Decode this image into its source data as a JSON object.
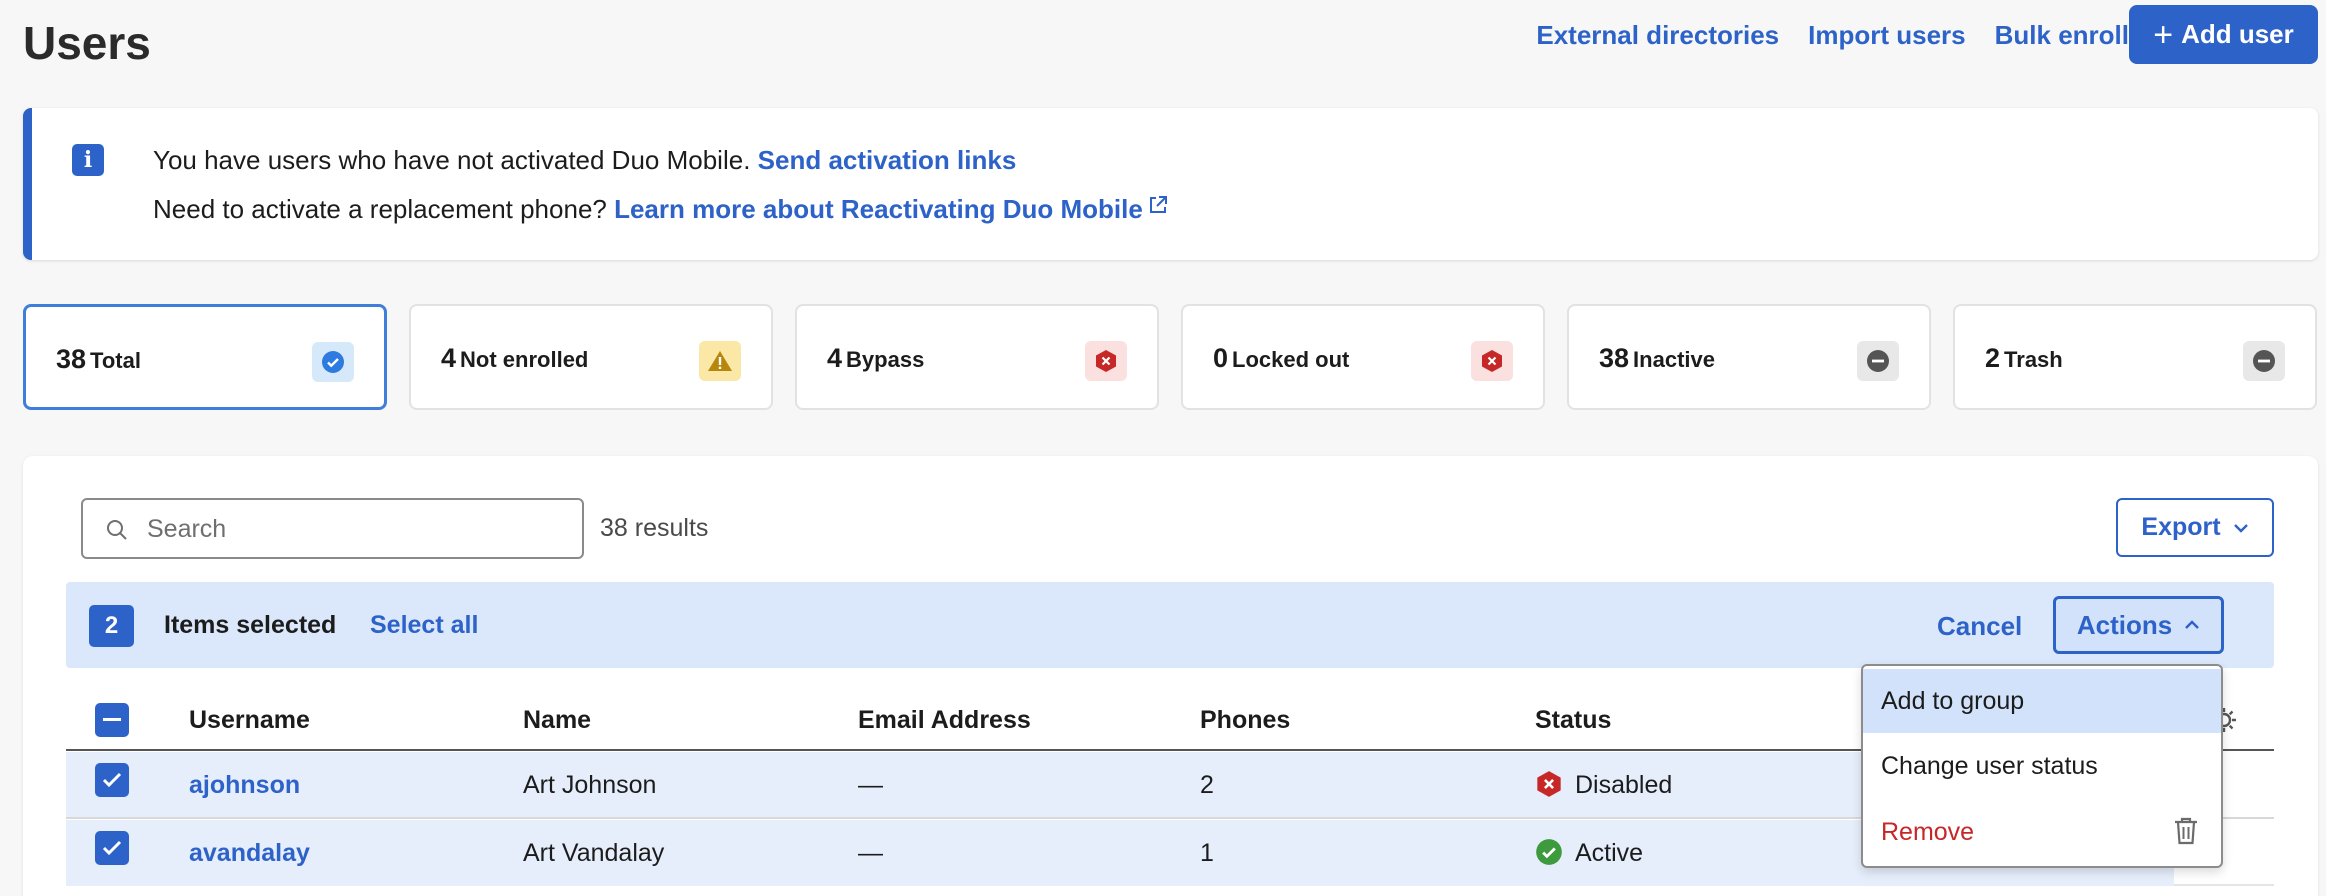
{
  "page": {
    "title": "Users"
  },
  "header": {
    "links": [
      "External directories",
      "Import users",
      "Bulk enroll"
    ],
    "add_user": "Add user"
  },
  "banner": {
    "line1_text": "You have users who have not activated Duo Mobile.",
    "line1_link": "Send activation links",
    "line2_text": "Need to activate a replacement phone?",
    "line2_link": "Learn more about Reactivating Duo Mobile"
  },
  "stats": [
    {
      "count": "38",
      "label": "Total",
      "icon": "check-circle-icon",
      "badge_bg": "#d6e9fb",
      "icon_color": "#2d7be0"
    },
    {
      "count": "4",
      "label": "Not enrolled",
      "icon": "warning-icon",
      "badge_bg": "#fbe8a6",
      "icon_color": "#b8860b"
    },
    {
      "count": "4",
      "label": "Bypass",
      "icon": "x-hexagon-icon",
      "badge_bg": "#fbe0e0",
      "icon_color": "#c62828"
    },
    {
      "count": "0",
      "label": "Locked out",
      "icon": "x-hexagon-icon",
      "badge_bg": "#fbe0e0",
      "icon_color": "#c62828"
    },
    {
      "count": "38",
      "label": "Inactive",
      "icon": "minus-circle-icon",
      "badge_bg": "#e8e8e8",
      "icon_color": "#555555"
    },
    {
      "count": "2",
      "label": "Trash",
      "icon": "minus-circle-icon",
      "badge_bg": "#e8e8e8",
      "icon_color": "#555555"
    }
  ],
  "search": {
    "placeholder": "Search",
    "results": "38 results"
  },
  "export": {
    "label": "Export"
  },
  "selection": {
    "count": "2",
    "label": "Items selected",
    "select_all": "Select all",
    "cancel": "Cancel",
    "actions": "Actions"
  },
  "table": {
    "columns": [
      "Username",
      "Name",
      "Email Address",
      "Phones",
      "Status"
    ],
    "rows": [
      {
        "username": "ajohnson",
        "name": "Art Johnson",
        "email": "—",
        "phones": "2",
        "status": "Disabled"
      },
      {
        "username": "avandalay",
        "name": "Art Vandalay",
        "email": "—",
        "phones": "1",
        "status": "Active"
      }
    ]
  },
  "actions_menu": {
    "items": [
      "Add to group",
      "Change user status",
      "Remove"
    ]
  },
  "colors": {
    "accent": "#2d62c8",
    "danger": "#c72727",
    "success": "#3d9a3d",
    "selection_bg": "#dbe8fb"
  }
}
